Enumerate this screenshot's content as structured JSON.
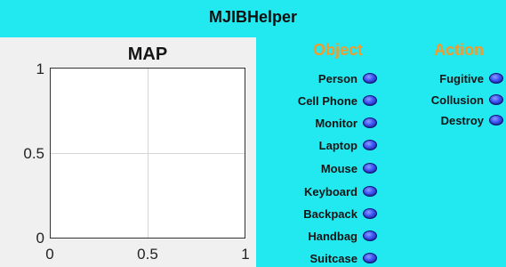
{
  "window": {
    "title": "MJIBHelper"
  },
  "map": {
    "title": "MAP",
    "yticks": [
      "1",
      "0.5",
      "0"
    ],
    "xticks": [
      "0",
      "0.5",
      "1"
    ]
  },
  "object": {
    "header": "Object",
    "items": [
      "Person",
      "Cell Phone",
      "Monitor",
      "Laptop",
      "Mouse",
      "Keyboard",
      "Backpack",
      "Handbag",
      "Suitcase"
    ]
  },
  "action": {
    "header": "Action",
    "items": [
      "Fugitive",
      "Collusion",
      "Destroy"
    ]
  },
  "colors": {
    "background": "#22e8f0",
    "header_text": "#f59a2a",
    "radio_blue": "#3d52f5",
    "map_panel": "#f0f0f0"
  }
}
